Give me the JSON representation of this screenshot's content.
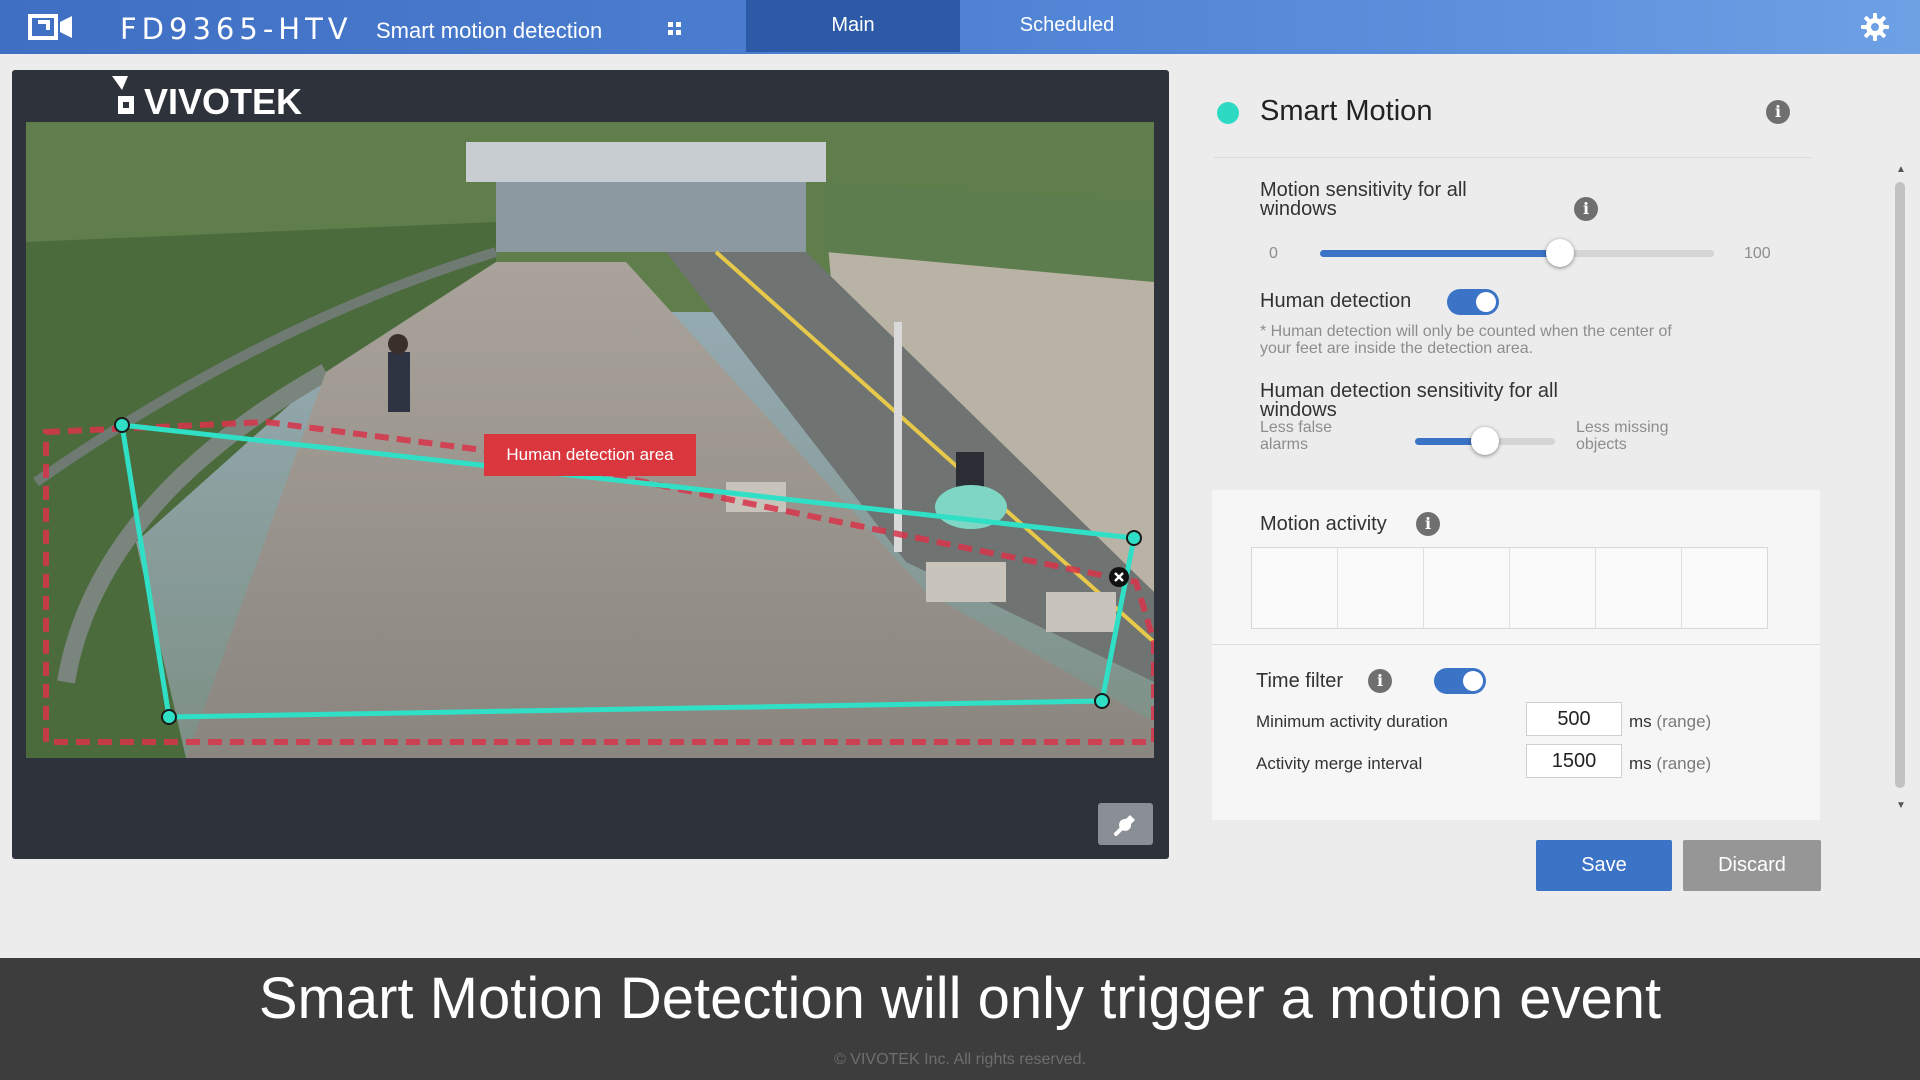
{
  "header": {
    "model": "FD9365-HTV",
    "page_name": "Smart motion detection",
    "tabs": [
      {
        "label": "Main",
        "active": true
      },
      {
        "label": "Scheduled",
        "active": false
      }
    ],
    "icons": [
      "camera-logo-icon",
      "grid-icon",
      "gear-icon"
    ]
  },
  "video": {
    "brand": "VIVOTEK",
    "zone_label": "Human detection area",
    "icons": [
      "close-icon",
      "wrench-icon"
    ]
  },
  "smart_motion": {
    "title": "Smart Motion",
    "status_color": "#2ed9c3",
    "sensitivity": {
      "label_line1": "Motion sensitivity for all",
      "label_line2": "windows",
      "min": "0",
      "max": "100",
      "value": 61
    },
    "human_detection": {
      "label": "Human detection",
      "enabled": true,
      "note_line1": "* Human detection will only be counted when the center of",
      "note_line2": "your feet are inside the detection area."
    },
    "human_sensitivity": {
      "label_line1": "Human detection sensitivity for all",
      "label_line2": "windows",
      "left_line1": "Less false",
      "left_line2": "alarms",
      "right_line1": "Less missing",
      "right_line2": "objects",
      "value": 0.5
    },
    "motion_activity": {
      "label": "Motion activity"
    },
    "time_filter": {
      "label": "Time filter",
      "enabled": true,
      "min_duration_label": "Minimum activity duration",
      "min_duration_value": "500",
      "merge_interval_label": "Activity merge interval",
      "merge_interval_value": "1500",
      "unit": "ms",
      "range": "(range)"
    },
    "save_label": "Save",
    "discard_label": "Discard"
  },
  "caption": "Smart Motion Detection will only trigger a motion event",
  "footer": "© VIVOTEK Inc. All rights reserved.",
  "colors": {
    "accent": "#3b73c6",
    "zone_outline": "#2fe0c6",
    "zone_label_bg": "#d9363e"
  }
}
